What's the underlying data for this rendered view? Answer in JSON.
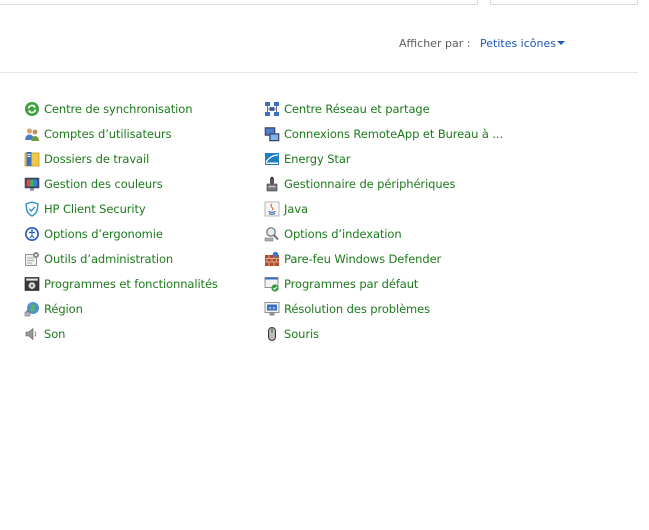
{
  "view_by": {
    "label": "Afficher par :",
    "value": "Petites icônes"
  },
  "colors": {
    "link_green": "#1d7a1d",
    "link_blue": "#1a5bb4",
    "divider": "#e4e8ee"
  },
  "items_left": [
    {
      "label": "Centre de synchronisation",
      "icon": "sync-center-icon"
    },
    {
      "label": "Comptes d’utilisateurs",
      "icon": "user-accounts-icon"
    },
    {
      "label": "Dossiers de travail",
      "icon": "work-folders-icon"
    },
    {
      "label": "Gestion des couleurs",
      "icon": "color-management-icon"
    },
    {
      "label": "HP Client Security",
      "icon": "shield-icon"
    },
    {
      "label": "Options d’ergonomie",
      "icon": "ease-of-access-icon"
    },
    {
      "label": "Outils d’administration",
      "icon": "admin-tools-icon"
    },
    {
      "label": "Programmes et fonctionnalités",
      "icon": "programs-features-icon"
    },
    {
      "label": "Région",
      "icon": "region-globe-icon"
    },
    {
      "label": "Son",
      "icon": "speaker-icon"
    }
  ],
  "items_right": [
    {
      "label": "Centre Réseau et partage",
      "icon": "network-icon"
    },
    {
      "label": "Connexions RemoteApp et Bureau à ...",
      "icon": "remote-desktop-icon"
    },
    {
      "label": "Energy Star",
      "icon": "energy-star-icon"
    },
    {
      "label": "Gestionnaire de périphériques",
      "icon": "device-manager-icon"
    },
    {
      "label": "Java",
      "icon": "java-icon"
    },
    {
      "label": "Options d’indexation",
      "icon": "indexing-icon"
    },
    {
      "label": "Pare-feu Windows Defender",
      "icon": "firewall-icon"
    },
    {
      "label": "Programmes par défaut",
      "icon": "default-programs-icon"
    },
    {
      "label": "Résolution des problèmes",
      "icon": "troubleshooting-icon"
    },
    {
      "label": "Souris",
      "icon": "mouse-icon"
    }
  ]
}
